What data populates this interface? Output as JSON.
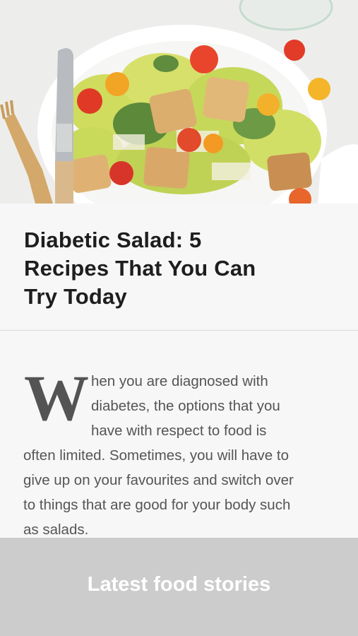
{
  "article": {
    "title": "Diabetic Salad: 5 Recipes That You Can Try Today",
    "title_lines": [
      "Diabetic Salad: 5",
      "Recipes That You Can",
      "Try Today"
    ],
    "drop_cap": "W",
    "body_lines": [
      "hen you are diagnosed with",
      "diabetes, the options that you",
      "have with respect to food is",
      "often limited. Sometimes, you will have to",
      "give up on your favourites and switch over",
      "to things that are good for your body such",
      "as salads."
    ]
  },
  "cta": {
    "label": "Latest food stories"
  },
  "hero": {
    "image": "caesar-salad-plate-photo",
    "colors": {
      "lettuce": "#c9d95a",
      "tomato": "#e8452c",
      "crouton": "#d9a868",
      "plate": "#ffffff"
    }
  }
}
